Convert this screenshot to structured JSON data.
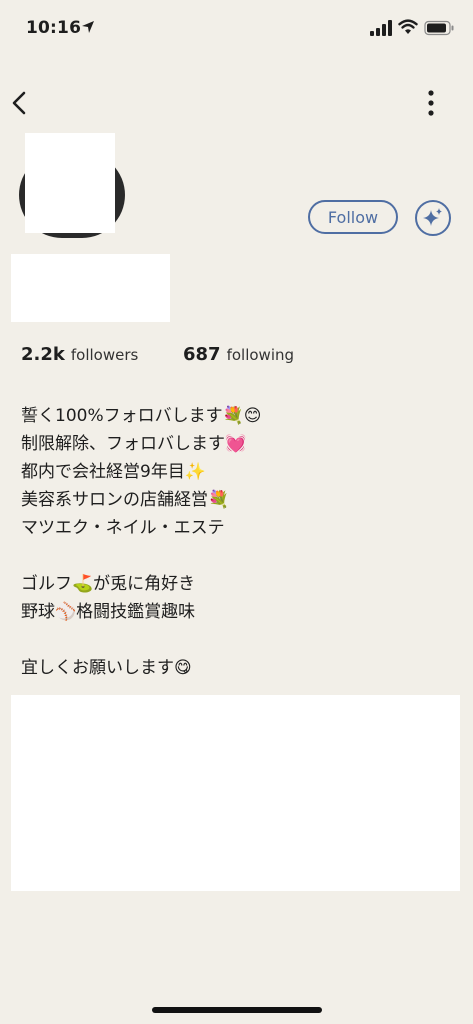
{
  "status": {
    "time": "10:16",
    "icons": [
      "location-arrow-icon",
      "cellular-signal-icon",
      "wifi-icon",
      "battery-icon"
    ]
  },
  "nav": {
    "back_icon": "chevron-left-icon",
    "more_icon": "vertical-ellipsis-icon"
  },
  "profile": {
    "follow_label": "Follow",
    "sparkle_icon": "sparkle-icon",
    "followers_count": "2.2k",
    "followers_label": "followers",
    "following_count": "687",
    "following_label": "following"
  },
  "bio": {
    "lines": [
      "誓く100%フォロバします💐😊",
      "制限解除、フォロバします💓",
      "都内で会社経営9年目✨",
      "美容系サロンの店舗経営💐",
      "マツエク・ネイル・エステ",
      "",
      "ゴルフ⛳が兎に角好き",
      "野球⚾格闘技鑑賞趣味",
      "",
      "宜しくお願いします😋"
    ]
  },
  "colors": {
    "background": "#f2efe8",
    "accent": "#4f6ea3",
    "text": "#1e1e1e"
  }
}
